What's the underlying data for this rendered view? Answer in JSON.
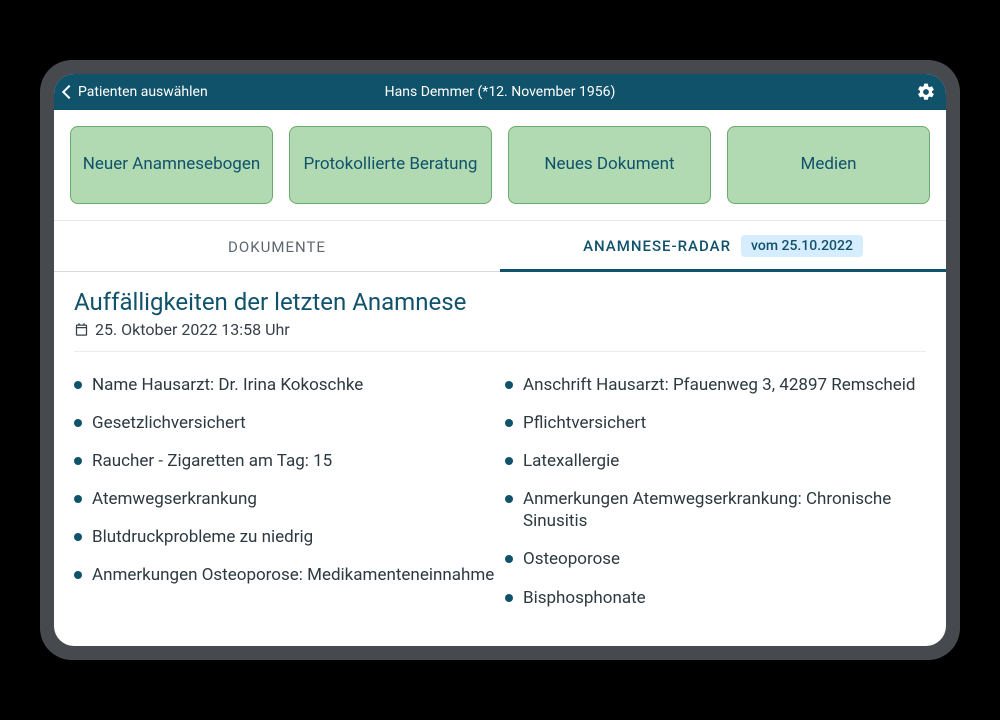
{
  "topbar": {
    "back_label": "Patienten auswählen",
    "patient_title": "Hans Demmer (*12. November 1956)"
  },
  "actions": {
    "new_anamnesis": "Neuer Anamnesebogen",
    "consultation": "Protokollierte Beratung",
    "new_document": "Neues Dokument",
    "media": "Medien"
  },
  "tabs": {
    "documents": "DOKUMENTE",
    "radar": "ANAMNESE-RADAR",
    "radar_badge": "vom 25.10.2022"
  },
  "radar": {
    "title": "Auffälligkeiten der letzten Anamnese",
    "timestamp": "25. Oktober 2022 13:58 Uhr",
    "items": [
      "Name Hausarzt: Dr. Irina Kokoschke",
      "Gesetzlichversichert",
      "Raucher - Zigaretten am Tag: 15",
      "Atemwegserkrankung",
      "Blutdruckprobleme zu niedrig",
      "Anmerkungen Osteoporose: Medikamenteneinnahme",
      "Anschrift Hausarzt: Pfauenweg 3, 42897 Remscheid",
      "Pflichtversichert",
      "Latexallergie",
      "Anmerkungen Atemwegserkrankung: Chronische Sinusitis",
      "Osteoporose",
      "Bisphosphonate"
    ]
  }
}
